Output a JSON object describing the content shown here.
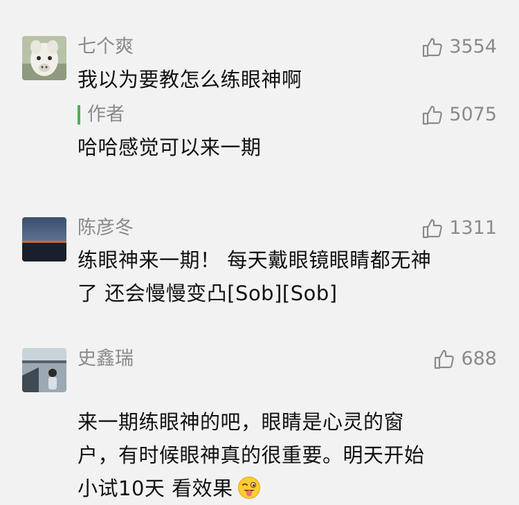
{
  "comments": [
    {
      "author": "七个爽",
      "likes": "3554",
      "text": "我以为要教怎么练眼神啊",
      "reply": {
        "author": "作者",
        "likes": "5075",
        "text": "哈哈感觉可以来一期"
      }
    },
    {
      "author": "陈彦冬",
      "likes": "1311",
      "text": "练眼神来一期！ 每天戴眼镜眼睛都无神\n了 还会慢慢变凸[Sob][Sob]"
    },
    {
      "author": "史鑫瑞",
      "likes": "688",
      "text": "来一期练眼神的吧，眼睛是心灵的窗\n户，有时候眼神真的很重要。明天开始\n小试10天 看效果"
    }
  ],
  "icons": {
    "like": "thumbs-up-icon",
    "emoji": "winking-tongue-emoji-icon"
  },
  "colors": {
    "reply_bar": "#4caf50",
    "meta_text": "#8a8a8a",
    "body_text": "#111111",
    "background": "#f2f2f2"
  }
}
